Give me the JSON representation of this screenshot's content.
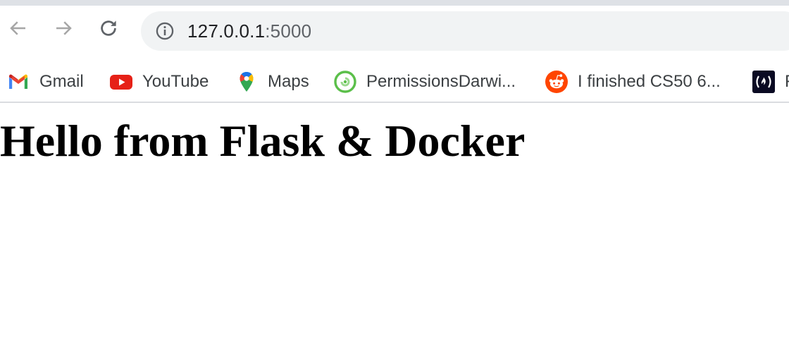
{
  "browser": {
    "url": {
      "host": "127.0.0.1",
      "port": ":5000"
    },
    "icons": {
      "back": "arrow-left-icon",
      "forward": "arrow-right-icon",
      "reload": "reload-icon",
      "site_info": "info-icon"
    }
  },
  "bookmarks": [
    {
      "label": "Gmail",
      "icon": "gmail-icon"
    },
    {
      "label": "YouTube",
      "icon": "youtube-icon"
    },
    {
      "label": "Maps",
      "icon": "maps-icon"
    },
    {
      "label": "PermissionsDarwi...",
      "icon": "permissions-icon"
    },
    {
      "label": "I finished CS50 6...",
      "icon": "reddit-icon"
    },
    {
      "label": "F",
      "icon": "freecodecamp-icon"
    }
  ],
  "page": {
    "heading": "Hello from Flask & Docker"
  },
  "colors": {
    "tab_strip": "#dee1e6",
    "omnibox": "#f1f3f4",
    "nav_disabled": "#a6a6a6",
    "nav_enabled": "#5f6368",
    "youtube": "#e62117",
    "reddit": "#ff4500",
    "permissions": "#5bbf4a"
  }
}
